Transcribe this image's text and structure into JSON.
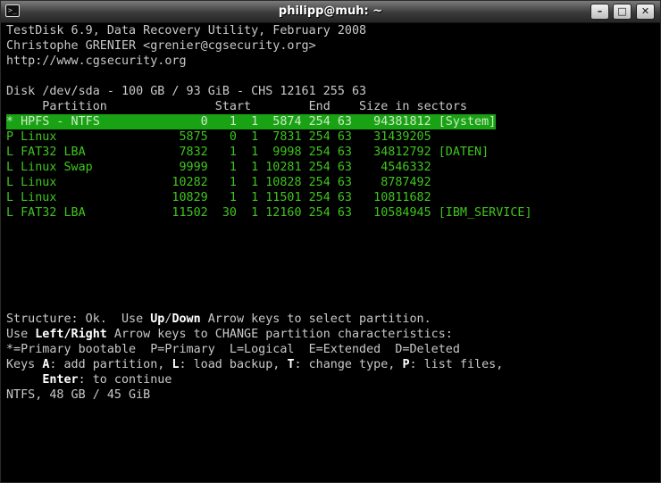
{
  "window": {
    "title": "philipp@muh: ~",
    "menu_icon": "terminal-icon",
    "buttons": {
      "minimize": "–",
      "maximize": "□",
      "close": "✕"
    }
  },
  "header": {
    "line1": "TestDisk 6.9, Data Recovery Utility, February 2008",
    "line2": "Christophe GRENIER <grenier@cgsecurity.org>",
    "line3": "http://www.cgsecurity.org"
  },
  "disk": {
    "line": "Disk /dev/sda - 100 GB / 93 GiB - CHS 12161 255 63",
    "columns": "     Partition               Start        End    Size in sectors"
  },
  "partitions": [
    "* HPFS - NTFS              0   1  1  5874 254 63   94381812 [System]",
    "P Linux                 5875   0  1  7831 254 63   31439205",
    "L FAT32 LBA             7832   1  1  9998 254 63   34812792 [DATEN]",
    "L Linux Swap            9999   1  1 10281 254 63    4546332",
    "L Linux                10282   1  1 10828 254 63    8787492",
    "L Linux                10829   1  1 11501 254 63   10811682",
    "L FAT32 LBA            11502  30  1 12160 254 63   10584945 [IBM_SERVICE]"
  ],
  "help": {
    "l1_a": "Structure: Ok.  Use ",
    "l1_up": "Up",
    "l1_slash": "/",
    "l1_down": "Down",
    "l1_b": " Arrow keys to select partition.",
    "l2_a": "Use ",
    "l2_lr": "Left/Right",
    "l2_b": " Arrow keys to CHANGE partition characteristics:",
    "l3": "*=Primary bootable  P=Primary  L=Logical  E=Extended  D=Deleted",
    "l4_a": "Keys ",
    "l4_k1": "A",
    "l4_b": ": add partition, ",
    "l4_k2": "L",
    "l4_c": ": load backup, ",
    "l4_k3": "T",
    "l4_d": ": change type, ",
    "l4_k4": "P",
    "l4_e": ": list files,",
    "l5_indent": "     ",
    "l5_k": "Enter",
    "l5_b": ": to continue",
    "l6": "NTFS, 48 GB / 45 GiB"
  },
  "colors": {
    "background": "#000000",
    "text": "#c9c9c9",
    "partition_text": "#3fc51d",
    "selection_bg": "#19a314"
  }
}
